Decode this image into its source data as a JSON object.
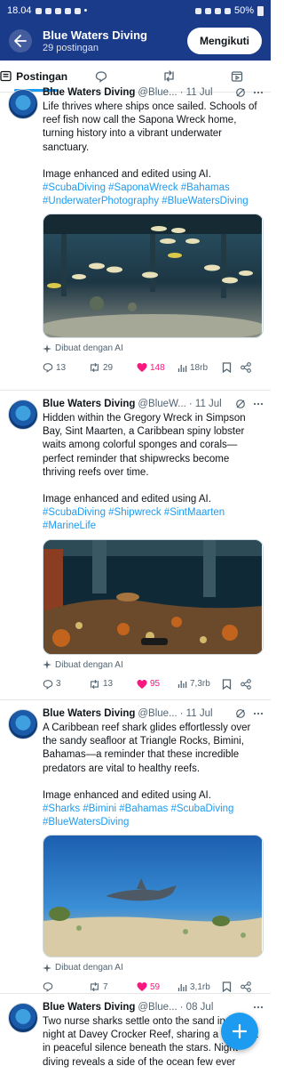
{
  "status_bar": {
    "time": "18.04",
    "battery": "50%"
  },
  "header": {
    "name": "Blue Waters Diving",
    "post_count": "29 postingan",
    "follow_label": "Mengikuti"
  },
  "tabs": {
    "posts_label": "Postingan"
  },
  "posts": [
    {
      "name": "Blue Waters Diving",
      "handle": "@Blue...",
      "date": "· 11 Jul",
      "text": "Life thrives where ships once sailed. Schools of reef fish now call the Sapona Wreck home, turning history into a vibrant underwater sanctuary.",
      "edit_note": "Image enhanced and edited using AI.",
      "hashtags": "#ScubaDiving #SaponaWreck #Bahamas #UnderwaterPhotography #BlueWatersDiving",
      "ai_label": "Dibuat dengan AI",
      "replies": "13",
      "reposts": "29",
      "likes": "148",
      "views": "18rb"
    },
    {
      "name": "Blue Waters Diving",
      "handle": "@BlueW...",
      "date": "· 11 Jul",
      "text": "Hidden within the Gregory Wreck in Simpson Bay, Sint Maarten, a Caribbean spiny lobster waits among colorful sponges and corals—perfect reminder that shipwrecks become thriving reefs over time.",
      "edit_note": "Image enhanced and edited using AI.",
      "hashtags": "#ScubaDiving #Shipwreck #SintMaarten #MarineLife",
      "ai_label": "Dibuat dengan AI",
      "replies": "3",
      "reposts": "13",
      "likes": "95",
      "views": "7,3rb"
    },
    {
      "name": "Blue Waters Diving",
      "handle": "@Blue...",
      "date": "· 11 Jul",
      "text": "A Caribbean reef shark glides effortlessly over the sandy seafloor at Triangle Rocks, Bimini, Bahamas—a reminder that these incredible predators are vital to healthy reefs.",
      "edit_note": "Image enhanced and edited using AI.",
      "hashtags": "#Sharks #Bimini #Bahamas #ScubaDiving #BlueWatersDiving",
      "ai_label": "Dibuat dengan AI",
      "replies": "",
      "reposts": "7",
      "likes": "59",
      "views": "3,1rb"
    },
    {
      "name": "Blue Waters Diving",
      "handle": "@Blue...",
      "date": "· 08 Jul",
      "text": "Two nurse sharks settle onto the sand in the night at Davey Crocker Reef, sharing a moment in peaceful silence beneath the stars. Night diving reveals a side of the ocean few ever"
    }
  ],
  "colors": {
    "header_bg": "#1a3a8a",
    "accent": "#1d9bf0",
    "like": "#f91880"
  }
}
